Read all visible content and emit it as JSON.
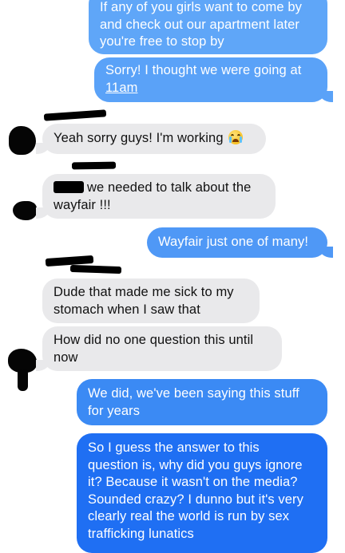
{
  "colors": {
    "sent_top": "#5fa6f8",
    "sent_mid": "#3f8ef5",
    "sent_bottom": "#1d6cf3",
    "received": "#e9e9eb"
  },
  "messages": [
    {
      "side": "sent",
      "lines": [
        "If any of you girls want to come by",
        "and check out our apartment later",
        "you're free to stop by"
      ]
    },
    {
      "side": "sent",
      "lines": [
        "Sorry! I thought we were going at"
      ],
      "link": "11am"
    },
    {
      "side": "received",
      "lines": [
        "Yeah sorry guys! I'm working"
      ],
      "emoji": "crying-face-icon"
    },
    {
      "side": "received",
      "lines": [
        "we needed to talk about the",
        "wayfair !!!"
      ]
    },
    {
      "side": "sent",
      "lines": [
        "Wayfair just one of many!"
      ]
    },
    {
      "side": "received",
      "lines": [
        "Dude that made me sick to my",
        "stomach when I saw that"
      ]
    },
    {
      "side": "received",
      "lines": [
        "How did no one question this until",
        "now"
      ]
    },
    {
      "side": "sent",
      "lines": [
        "We did, we've been saying this stuff",
        "for years"
      ]
    },
    {
      "side": "sent",
      "lines": [
        "So I guess the answer to this",
        "question is, why did you guys ignore",
        "it? Because it wasn't on the media?",
        "Sounded crazy? I dunno but it's very",
        "clearly real the world is run by sex",
        "trafficking lunatics"
      ]
    }
  ]
}
